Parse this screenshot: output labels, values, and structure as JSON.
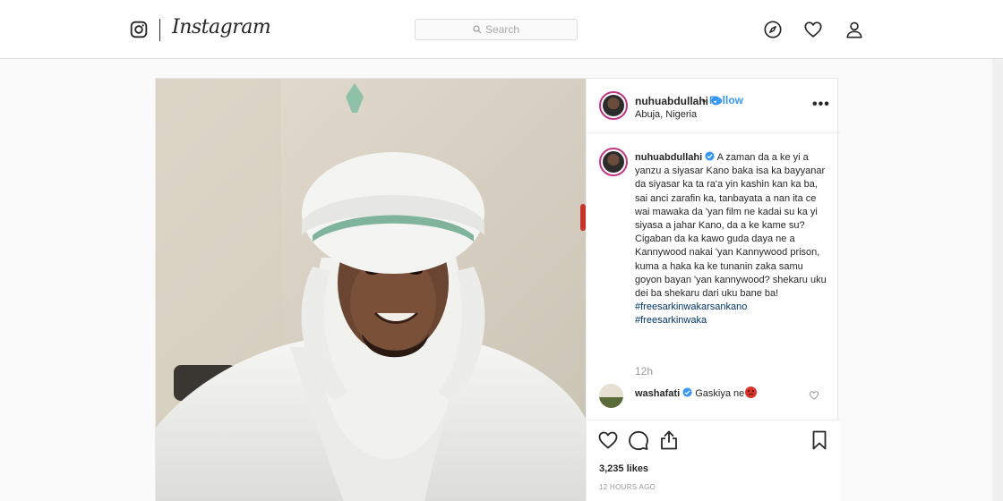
{
  "nav": {
    "brand": "Instagram",
    "search_placeholder": "Search",
    "icons": [
      "instagram-glyph-icon",
      "search-icon",
      "compass-icon",
      "heart-icon",
      "profile-icon"
    ]
  },
  "post": {
    "username": "nuhuabdullahi",
    "separator": "•",
    "follow_label": "Follow",
    "location": "Abuja, Nigeria",
    "more_label": "•••",
    "caption_user": "nuhuabdullahi",
    "caption_text": "A zaman da a ke yi a yanzu a siyasar Kano baka isa ka bayyanar da siyasar ka ta ra'a yin kashin kan ka ba, sai anci zarafin ka, tanbayata a nan ita ce wai mawaka da 'yan film ne kadai su ka yi siyasa a jahar Kano, da a ke kame su? Cigaban da ka kawo guda daya ne a Kannywood nakai 'yan Kannywood prison, kuma a haka ka ke tunanin zaka samu goyon bayan 'yan kannywood? shekaru uku dei ba shekaru dari uku bane ba!",
    "hashtags": [
      "#freesarkinwakarsankano",
      "#freesarkinwaka"
    ],
    "caption_time": "12h",
    "comment_user": "washafati",
    "comment_text": "Gaskiya ne",
    "likes": "3,235 likes",
    "timestamp": "12 HOURS AGO"
  },
  "colors": {
    "link": "#3897f0",
    "hashtag": "#003569",
    "verified": "#3897f0",
    "border": "#dbdbdb"
  }
}
